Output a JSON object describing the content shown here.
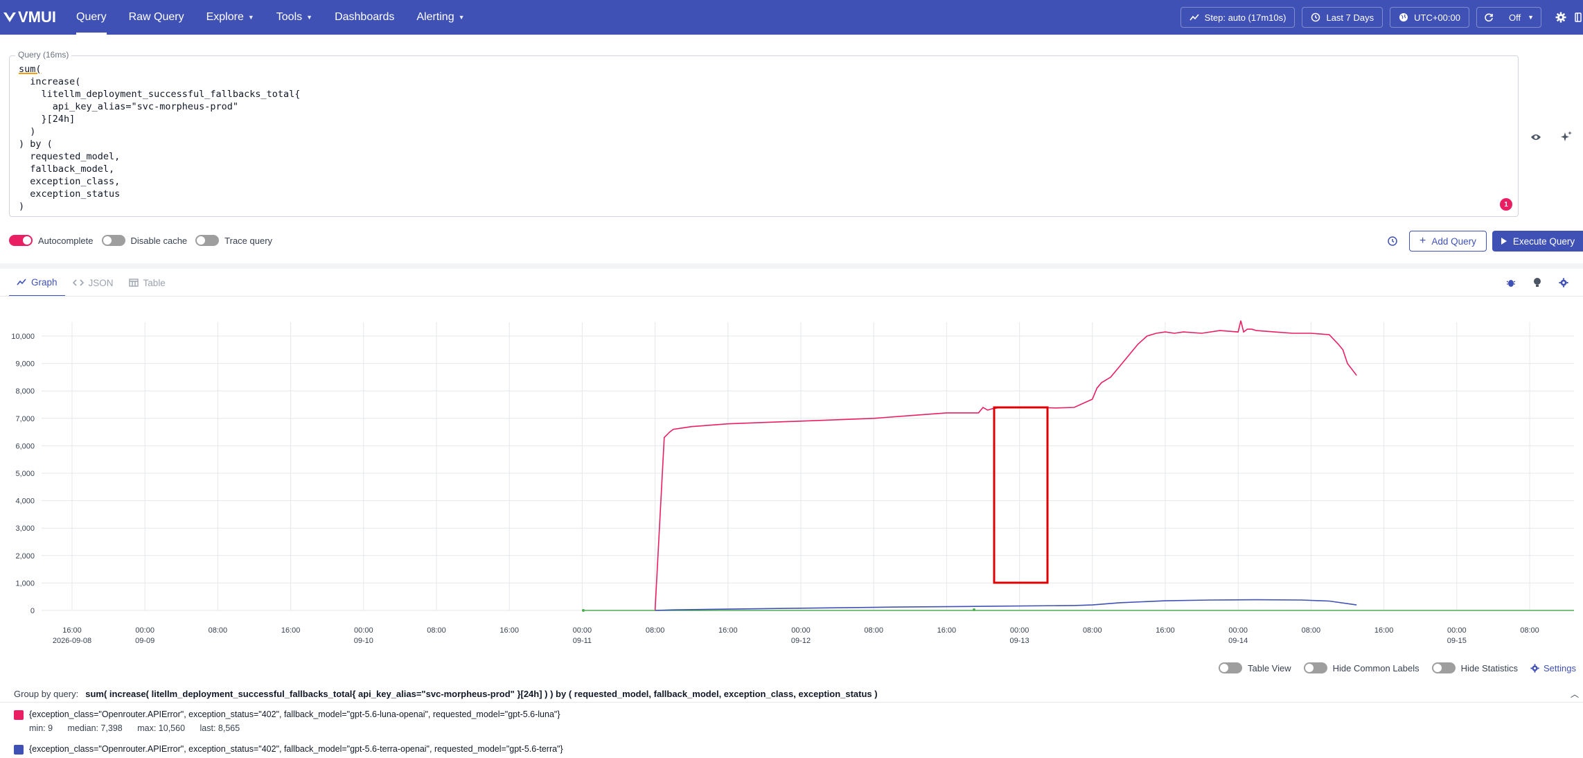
{
  "header": {
    "logo_text": "VMUI",
    "nav": [
      {
        "label": "Query",
        "active": true,
        "dropdown": false
      },
      {
        "label": "Raw Query",
        "active": false,
        "dropdown": false
      },
      {
        "label": "Explore",
        "active": false,
        "dropdown": true
      },
      {
        "label": "Tools",
        "active": false,
        "dropdown": true
      },
      {
        "label": "Dashboards",
        "active": false,
        "dropdown": false
      },
      {
        "label": "Alerting",
        "active": false,
        "dropdown": true
      }
    ],
    "step_label": "Step: auto (17m10s)",
    "range_label": "Last 7 Days",
    "timezone_label": "UTC+00:00",
    "refresh_label": "Off",
    "color": "#3f51b5"
  },
  "query": {
    "label": "Query (16ms)",
    "code_first": "sum(",
    "code_rest": "\n  increase(\n    litellm_deployment_successful_fallbacks_total{\n      api_key_alias=\"svc-morpheus-prod\"\n    }[24h]\n  )\n) by (\n  requested_model,\n  fallback_model,\n  exception_class,\n  exception_status\n)",
    "error_count": "1"
  },
  "options": {
    "autocomplete": "Autocomplete",
    "disable_cache": "Disable cache",
    "trace_query": "Trace query",
    "add_query": "Add Query",
    "execute_query": "Execute Query"
  },
  "tabs": [
    {
      "label": "Graph",
      "active": true
    },
    {
      "label": "JSON",
      "active": false
    },
    {
      "label": "Table",
      "active": false
    }
  ],
  "legend_controls": {
    "table_view": "Table View",
    "hide_common": "Hide Common Labels",
    "hide_stats": "Hide Statistics",
    "settings": "Settings"
  },
  "group_by": {
    "label": "Group by query:",
    "query": "sum( increase( litellm_deployment_successful_fallbacks_total{ api_key_alias=\"svc-morpheus-prod\" }[24h] ) ) by ( requested_model, fallback_model, exception_class, exception_status )"
  },
  "legend": [
    {
      "color": "#e91e63",
      "labels": "{exception_class=\"Openrouter.APIError\", exception_status=\"402\", fallback_model=\"gpt-5.6-luna-openai\", requested_model=\"gpt-5.6-luna\"}",
      "min": "min: 9",
      "median": "median: 7,398",
      "max": "max: 10,560",
      "last": "last: 8,565"
    },
    {
      "color": "#3f51b5",
      "labels": "{exception_class=\"Openrouter.APIError\", exception_status=\"402\", fallback_model=\"gpt-5.6-terra-openai\", requested_model=\"gpt-5.6-terra\"}",
      "min": "",
      "median": "",
      "max": "",
      "last": ""
    }
  ],
  "chart_data": {
    "type": "line",
    "x_ticks": [
      {
        "time": "16:00",
        "date": "2026-09-08"
      },
      {
        "time": "00:00",
        "date": "09-09"
      },
      {
        "time": "08:00",
        "date": ""
      },
      {
        "time": "16:00",
        "date": ""
      },
      {
        "time": "00:00",
        "date": "09-10"
      },
      {
        "time": "08:00",
        "date": ""
      },
      {
        "time": "16:00",
        "date": ""
      },
      {
        "time": "00:00",
        "date": "09-11"
      },
      {
        "time": "08:00",
        "date": ""
      },
      {
        "time": "16:00",
        "date": ""
      },
      {
        "time": "00:00",
        "date": "09-12"
      },
      {
        "time": "08:00",
        "date": ""
      },
      {
        "time": "16:00",
        "date": ""
      },
      {
        "time": "00:00",
        "date": "09-13"
      },
      {
        "time": "08:00",
        "date": ""
      },
      {
        "time": "16:00",
        "date": ""
      },
      {
        "time": "00:00",
        "date": "09-14"
      },
      {
        "time": "08:00",
        "date": ""
      },
      {
        "time": "16:00",
        "date": ""
      },
      {
        "time": "00:00",
        "date": "09-15"
      },
      {
        "time": "08:00",
        "date": ""
      }
    ],
    "y_ticks": [
      "0",
      "1,000",
      "2,000",
      "3,000",
      "4,000",
      "5,000",
      "6,000",
      "7,000",
      "8,000",
      "9,000",
      "10,000"
    ],
    "ylim": [
      0,
      10000
    ],
    "grid": true,
    "series": [
      {
        "color": "#e91e63",
        "x_hours": [
          64,
          65,
          65.6,
          66,
          67,
          68,
          70,
          72,
          76,
          80,
          84,
          88,
          92,
          96,
          99.5,
          100,
          100.5,
          101,
          102,
          104,
          106,
          108,
          110,
          112,
          112.5,
          113,
          114,
          115,
          116,
          117,
          118,
          119,
          120,
          121,
          122,
          124,
          126,
          128,
          128.3,
          128.6,
          129,
          129.5,
          130,
          132,
          134,
          136,
          138,
          139,
          139.5,
          140,
          141
        ],
        "values": [
          9,
          6300,
          6500,
          6600,
          6650,
          6700,
          6750,
          6800,
          6850,
          6900,
          6950,
          7000,
          7100,
          7200,
          7200,
          7400,
          7300,
          7350,
          7400,
          7400,
          7400,
          7380,
          7400,
          7700,
          8100,
          8300,
          8500,
          8900,
          9300,
          9700,
          10000,
          10100,
          10150,
          10100,
          10150,
          10100,
          10200,
          10150,
          10560,
          10150,
          10250,
          10250,
          10200,
          10150,
          10100,
          10100,
          10050,
          9700,
          9500,
          9000,
          8565
        ]
      },
      {
        "color": "#3f51b5",
        "x_hours": [
          64,
          66,
          70,
          80,
          90,
          100,
          110,
          112,
          115,
          120,
          125,
          130,
          135,
          138,
          141
        ],
        "values": [
          0,
          20,
          40,
          80,
          120,
          150,
          180,
          200,
          280,
          350,
          380,
          390,
          380,
          340,
          200
        ]
      },
      {
        "color": "#4caf50",
        "x_hours": [
          0,
          141
        ],
        "values": [
          0,
          0
        ]
      }
    ]
  }
}
